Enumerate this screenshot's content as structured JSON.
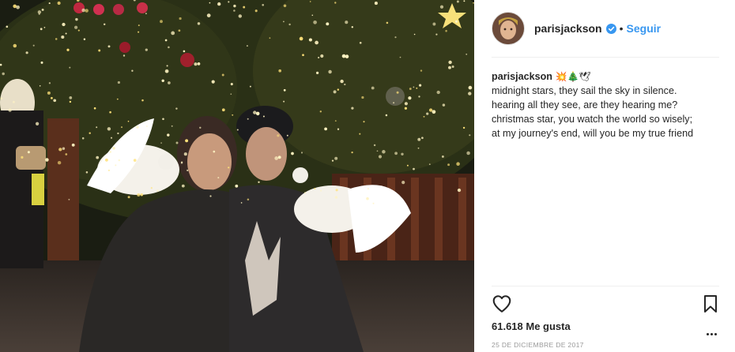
{
  "post": {
    "username": "parisjackson",
    "follow_label": "Seguir",
    "separator": "•",
    "caption": {
      "username": "parisjackson",
      "emojis": "💥🎄🕊",
      "lines": [
        "midnight stars, they sail the sky in silence.",
        "hearing all they see, are they hearing me?",
        "christmas star, you watch the world so wisely;",
        "at my journey's end, will you be my true friend"
      ]
    },
    "likes_label": "61.618 Me gusta",
    "date": "25 DE DICIEMBRE DE 2017"
  },
  "icons": {
    "verified": "verified-badge-icon",
    "heart": "heart-icon",
    "bookmark": "bookmark-icon",
    "more": "more-options-icon"
  },
  "colors": {
    "accent": "#3897f0",
    "text": "#262626",
    "muted": "#999999",
    "divider": "#efefef"
  }
}
